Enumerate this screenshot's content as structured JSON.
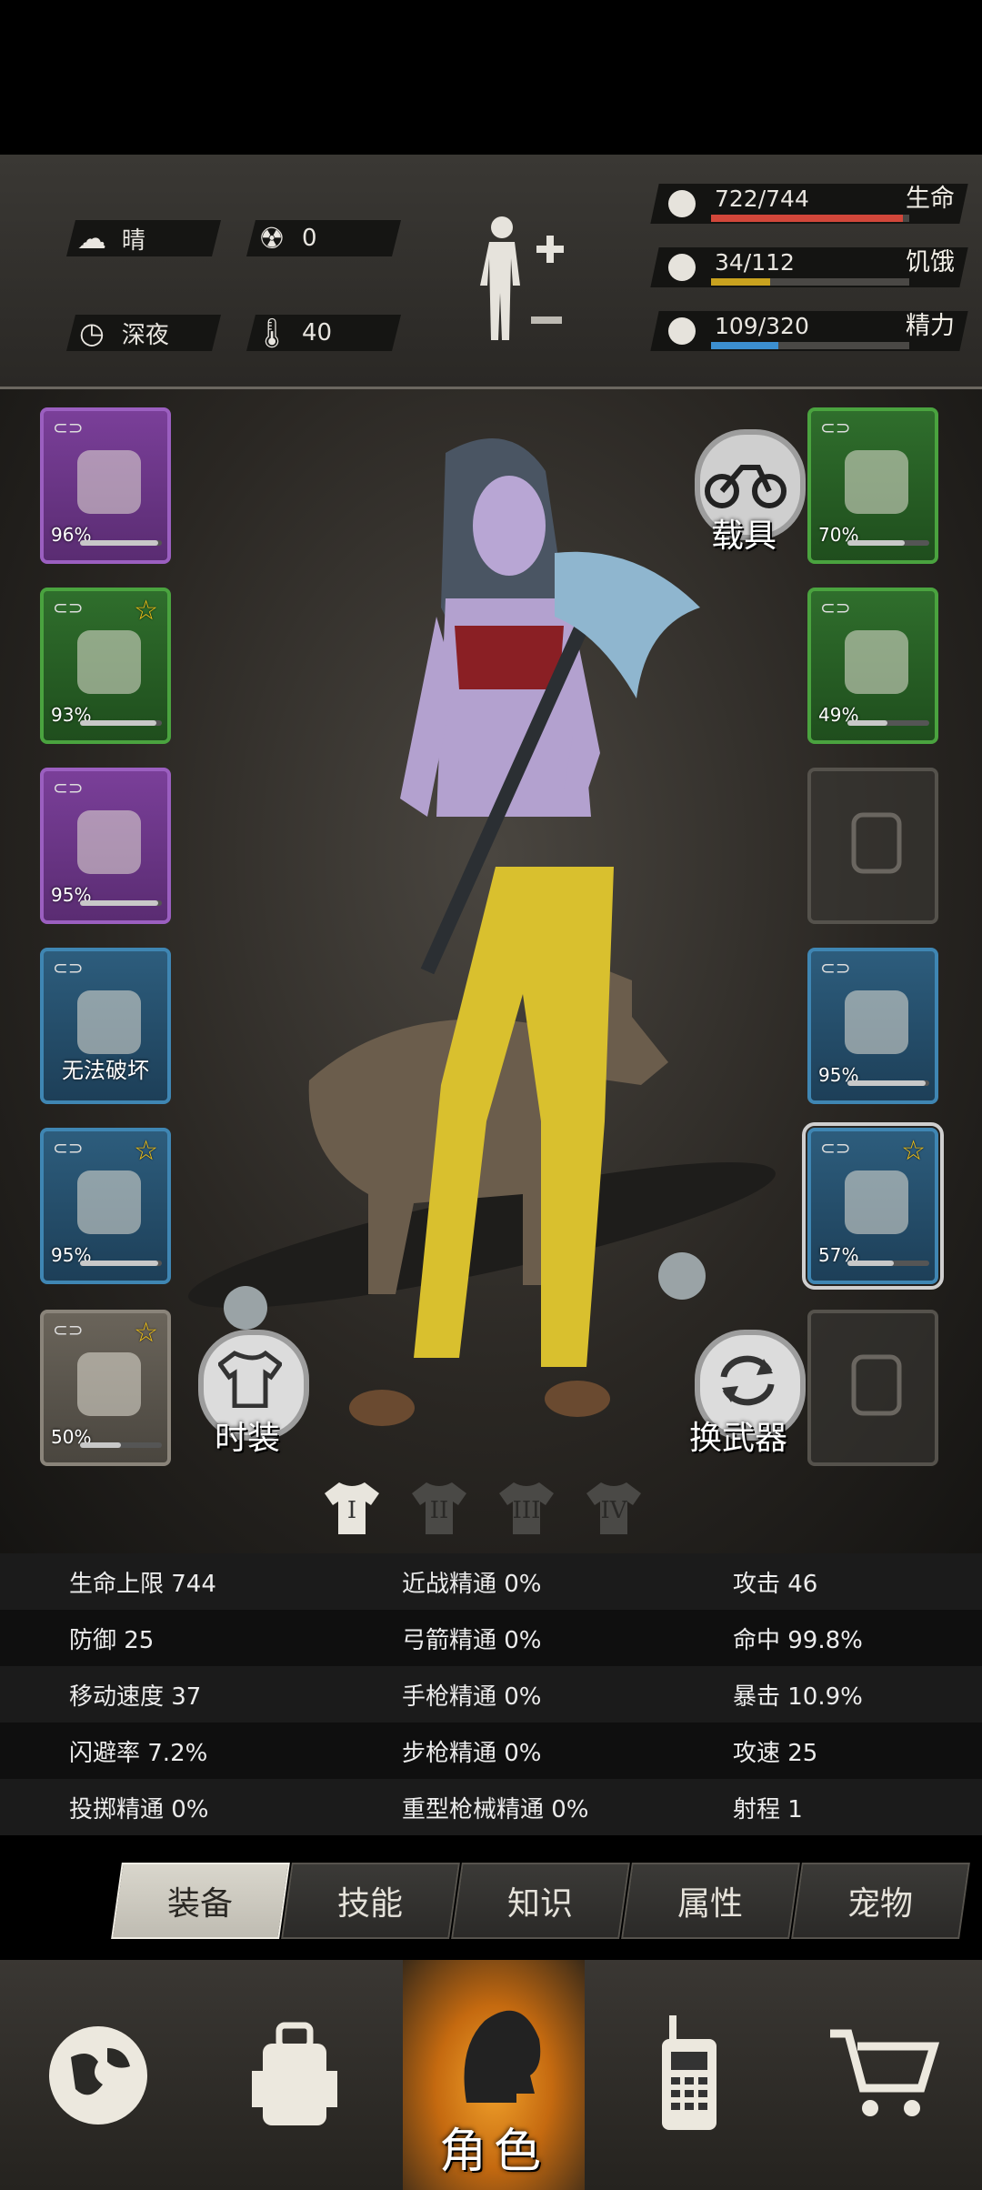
{
  "weather": {
    "condition": "晴",
    "radiation": "0",
    "time_of_day": "深夜",
    "temperature": "40"
  },
  "vitals": [
    {
      "label": "生命",
      "value": "722/744",
      "fraction": 0.97,
      "color": "#d2473a"
    },
    {
      "label": "饥饿",
      "value": "34/112",
      "fraction": 0.3,
      "color": "#c9a21f"
    },
    {
      "label": "精力",
      "value": "109/320",
      "fraction": 0.34,
      "color": "#3c8fd0"
    }
  ],
  "left_slots": [
    {
      "name": "helmet",
      "rarity": "purple",
      "durability": "96%",
      "starred": false
    },
    {
      "name": "shirt",
      "rarity": "green",
      "durability": "93%",
      "starred": true
    },
    {
      "name": "jacket",
      "rarity": "purple",
      "durability": "95%",
      "starred": false
    },
    {
      "name": "backpack",
      "rarity": "blue",
      "label": "无法破坏",
      "starred": false
    },
    {
      "name": "pants",
      "rarity": "blue",
      "durability": "95%",
      "starred": true
    },
    {
      "name": "shoes",
      "rarity": "gray",
      "durability": "50%",
      "starred": true
    }
  ],
  "right_slots": [
    {
      "name": "glasses",
      "rarity": "green",
      "durability": "70%",
      "starred": false
    },
    {
      "name": "mask",
      "rarity": "green",
      "durability": "49%",
      "starred": false
    },
    {
      "name": "bag-empty",
      "rarity": "empty"
    },
    {
      "name": "shield",
      "rarity": "blue",
      "durability": "95%",
      "starred": false
    },
    {
      "name": "axe",
      "rarity": "blue",
      "durability": "57%",
      "starred": true,
      "selected": true
    },
    {
      "name": "bottle-empty",
      "rarity": "empty"
    }
  ],
  "buttons": {
    "vehicle": "载具",
    "fashion": "时装",
    "swap_weapon": "换武器"
  },
  "outfit_sets": [
    "I",
    "II",
    "III",
    "IV"
  ],
  "stats": [
    [
      "生命上限 744",
      "近战精通 0%",
      "攻击 46"
    ],
    [
      "防御 25",
      "弓箭精通 0%",
      "命中 99.8%"
    ],
    [
      "移动速度 37",
      "手枪精通 0%",
      "暴击 10.9%"
    ],
    [
      "闪避率 7.2%",
      "步枪精通 0%",
      "攻速 25"
    ],
    [
      "投掷精通 0%",
      "重型枪械精通 0%",
      "射程 1"
    ]
  ],
  "tabs": [
    "装备",
    "技能",
    "知识",
    "属性",
    "宠物"
  ],
  "nav": {
    "active_label": "角色",
    "items": [
      "globe-icon",
      "backpack-icon",
      "character-icon",
      "radio-icon",
      "cart-icon"
    ]
  }
}
